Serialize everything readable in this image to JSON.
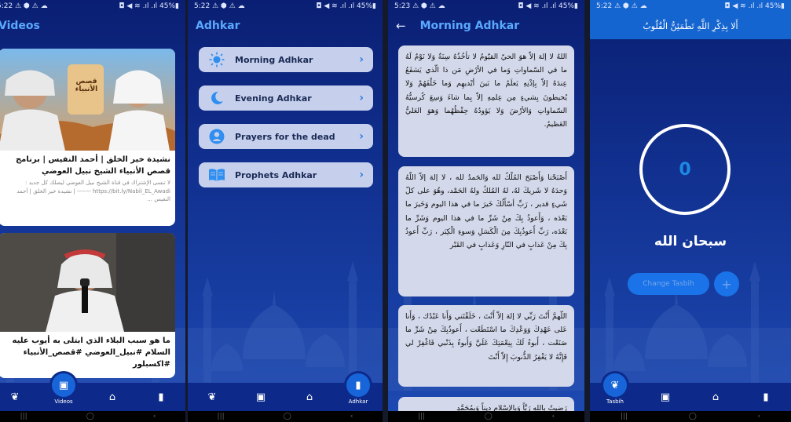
{
  "status": {
    "p1": {
      "time": "5:22 ⚠ ⬢ ⚠ ☁",
      "right": "◘ ◀ ≋ .ıl .ıl 45%▮"
    },
    "p2": {
      "time": "5:22 ⚠ ⬢ ⚠ ☁",
      "right": "◘ ◀ ≋ .ıl .ıl 45%▮"
    },
    "p3": {
      "time": "5:23 ⚠ ⬢ ⚠ ☁",
      "right": "◘ ◀ ≋ .ıl .ıl 45%▮"
    },
    "p4": {
      "time": "5:22 ⚠ ⬢ ⚠ ☁",
      "right": "◘ ◀ ≋ .ıl .ıl 45%▮"
    }
  },
  "videos": {
    "title": "Videos",
    "items": [
      {
        "title": "نشيدة خير الخلق | أحمد النفيس | برنامج قصص الأنبياء الشيخ نبيل العوضي",
        "desc": "لا تنسى الإشتراك في قناة الشيخ نبيل العوضي ليصلك كل جديد : https://bit.ly/Nabil_EL_Awadi ------- | نشيدة خير الخلق | أحمد النفيس ..."
      },
      {
        "title": "ما هو سبب البلاء الذي ابتلى به أيوب عليه السلام #نبيل_العوضي #قصص_الأنبياء #اكسبلور"
      }
    ],
    "thumb_logo": "قصص الأنبياء",
    "nav_label": "Videos"
  },
  "adhkar": {
    "title": "Adhkar",
    "items": [
      "Morning Adhkar",
      "Evening Adhkar",
      "Prayers for the dead",
      "Prophets Adhkar"
    ],
    "nav_label": "Adhkar"
  },
  "morning": {
    "title": "Morning Adhkar",
    "texts": [
      "اللهُ لا إلهَ إلاّ هوَ الحيّ القيّومُ لا تأخُذُهُ سِنَةٌ وَلا نَوْمٌ لَهُ ما في السّماواتِ وَما في الأرْضِ مَن ذا الّذي يَشفَعُ عِندَهُ إلاّ بِإذْنِهِ يَعلَمُ ما بَينَ أيْديهِم وَما خَلْفَهُمْ وَلا يُحيطونَ بِشيءٍ مِن عِلمِهِ إلاّ بِما شاءَ وَسِعَ كُرسيُّهُ السّماواتِ وَالأرْضَ وَلا يَؤودُهُ حِفْظُهُما وَهوَ العَليُّ العَظيمُ.",
      "أَصْبَحْنا وَأَصْبَحَ المُلْكُ لله وَالحَمدُ لله ، لا إلهَ إلاّ اللّهُ وَحدَهُ لا شَريكَ لهُ، لهُ المُلكُ ولهُ الحَمْد، وهُوَ على كلّ شَيءٍ قدير ، رَبِّ أسْأَلُكَ خَيرَ ما في هذا اليوم وَخَيرَ ما بَعْدَه ، وَأَعوذُ بِكَ مِنْ شَرِّ ما في هذا اليوم وَشَرِّ ما بَعْدَه، رَبِّ أَعوذُبِكَ مِنَ الْكَسَلِ وَسوءِ الْكِبَر ، رَبِّ أَعوذُ بِكَ مِنْ عَذابٍ في النّارِ وَعَذابٍ في القَبْر",
      "اللّهمَّ أَنْتَ رَبِّي لا إلهَ إلاّ أَنْتَ ، خَلَقْتَني وَأَنا عَبْدُك ، وَأَنا عَلى عَهْدِكَ وَوَعْدِكَ ما اسْتَطَعْت ، أَعوذُبِكَ مِنْ شَرِّ ما صَنَعْت ، أَبوءُ لَكَ بِنِعْمَتِكَ عَلَيَّ وَأَبوءُ بِذَنْبي فَاغْفِرْ لي فَإِنَّهُ لا يَغْفِرُ الذُّنوبَ إِلاّ أَنْتَ",
      "رَضيتُ بِاللهِ رَبَّاً وَبِالإسْلامِ ديناً وَبِمُحَمَّدٍ"
    ]
  },
  "tasbih": {
    "header": "أَلا بِذِكْرِ اللَّهِ تَطْمَئِنُّ الْقُلُوبُ",
    "count": "0",
    "zikr": "سبحان الله",
    "change_label": "Change Tasbih",
    "plus": "+",
    "nav_label": "Tasbih"
  },
  "sysnav": {
    "back": "|||",
    "home": "◯",
    "recent": "‹"
  },
  "colors": {
    "accent": "#1565d0",
    "title": "#5aa9ff",
    "bg_top": "#0a1f73",
    "card": "#c6d0ec"
  }
}
